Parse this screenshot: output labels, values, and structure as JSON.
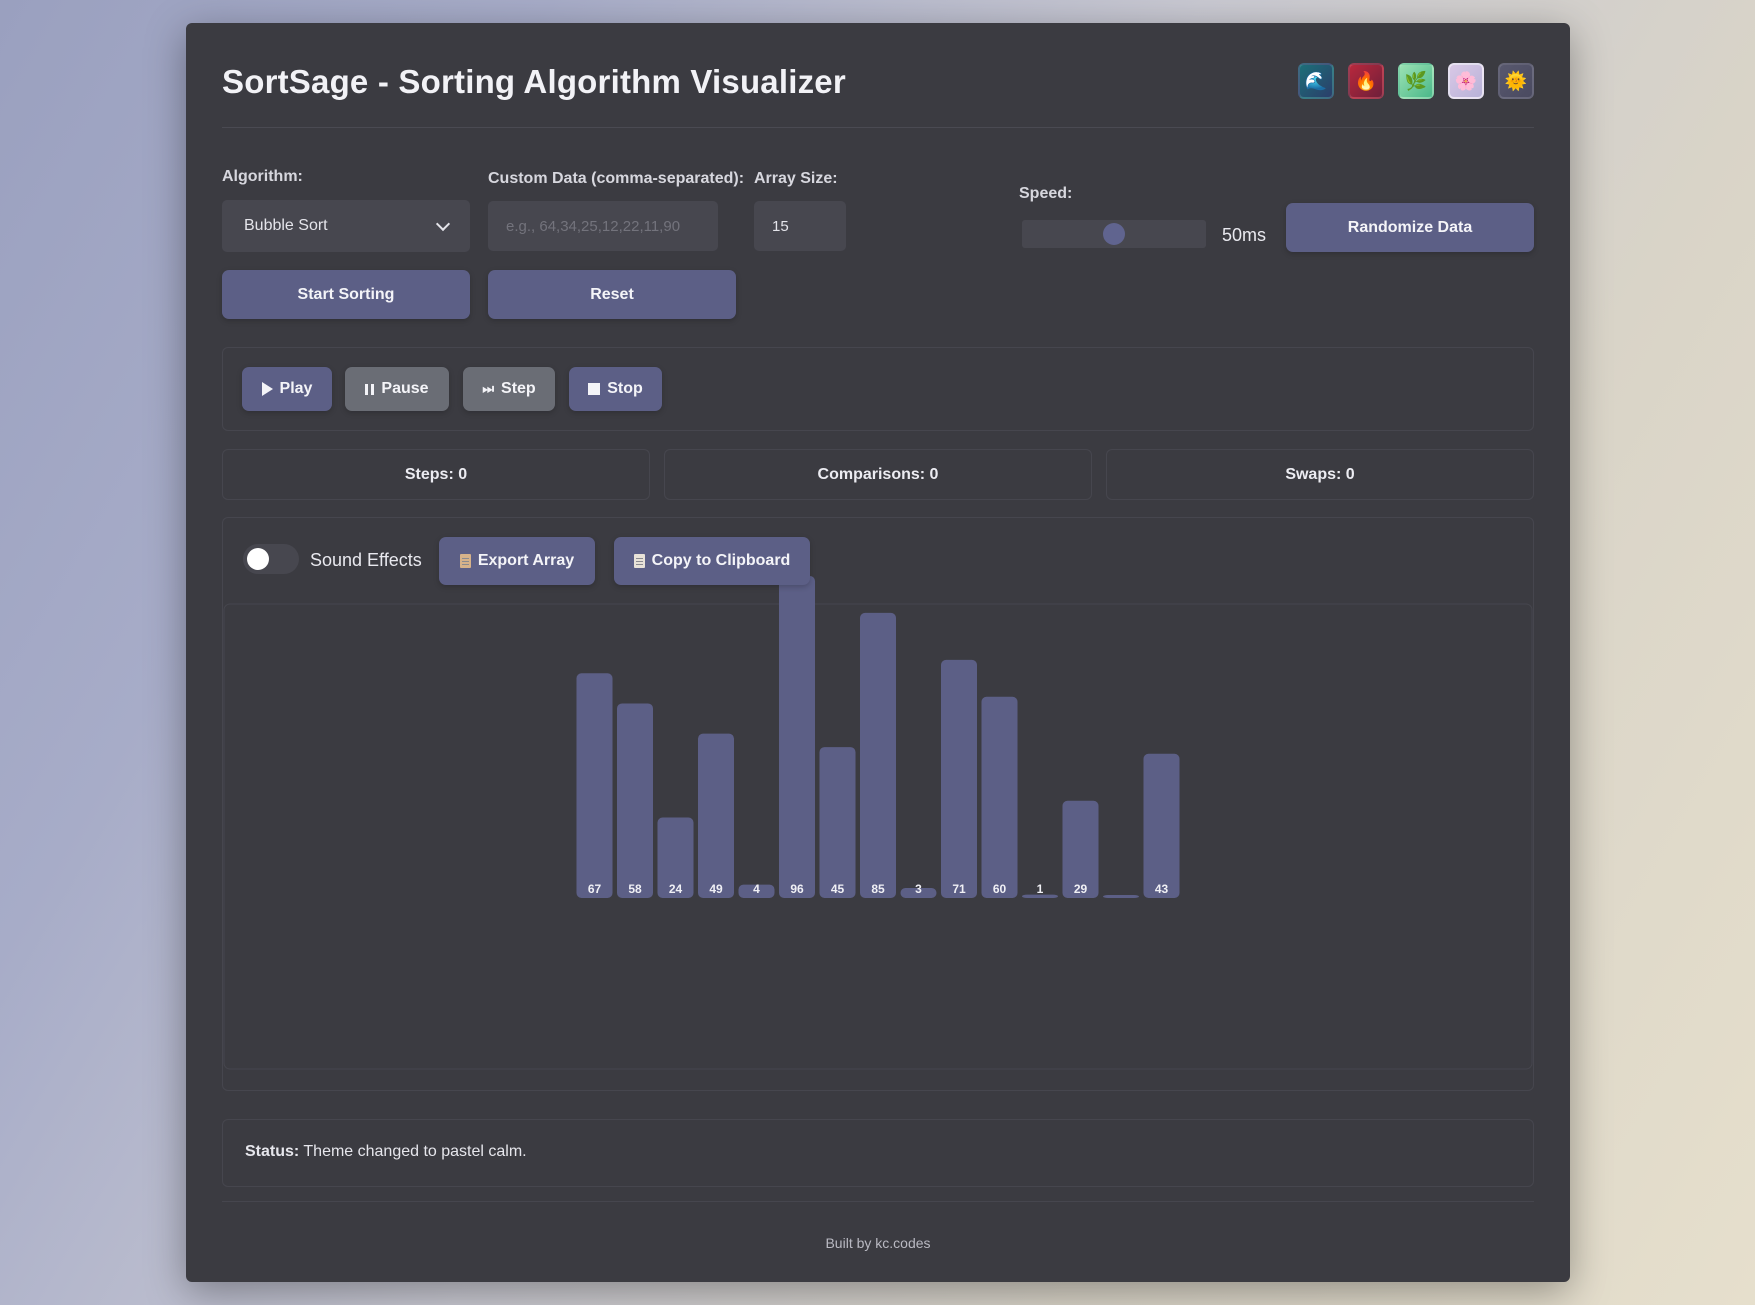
{
  "app": {
    "title": "SortSage - Sorting Algorithm Visualizer",
    "themes": [
      {
        "name": "ocean",
        "glyph": "🌊"
      },
      {
        "name": "fire",
        "glyph": "🔥"
      },
      {
        "name": "forest",
        "glyph": "🌿"
      },
      {
        "name": "pastel",
        "glyph": "🌸"
      },
      {
        "name": "sun",
        "glyph": "🌞"
      }
    ]
  },
  "controls": {
    "algorithm_label": "Algorithm:",
    "algorithm_value": "Bubble Sort",
    "custom_label": "Custom Data (comma-separated):",
    "custom_placeholder": "e.g., 64,34,25,12,22,11,90",
    "size_label": "Array Size:",
    "size_value": "15",
    "speed_label": "Speed:",
    "speed_fraction": 0.5,
    "speed_value": "50ms",
    "randomize_label": "Randomize Data",
    "start_label": "Start Sorting",
    "reset_label": "Reset"
  },
  "playback": {
    "play": "Play",
    "pause": "Pause",
    "step": "Step",
    "stop": "Stop"
  },
  "stats": {
    "steps": "Steps: 0",
    "comparisons": "Comparisons: 0",
    "swaps": "Swaps: 0"
  },
  "tools": {
    "sound_label": "Sound Effects",
    "sound_on": false,
    "export_label": "Export Array",
    "copy_label": "Copy to Clipboard"
  },
  "chart_data": {
    "type": "bar",
    "values": [
      67,
      58,
      24,
      49,
      4,
      96,
      45,
      85,
      3,
      71,
      60,
      1,
      29,
      0,
      43
    ],
    "labels": [
      "67",
      "58",
      "24",
      "49",
      "4",
      "96",
      "45",
      "85",
      "3",
      "71",
      "60",
      "1",
      "29",
      "",
      "43"
    ],
    "ylim": [
      0,
      96
    ],
    "bar_color": "#5c5f86"
  },
  "status": {
    "label": "Status:",
    "message": " Theme changed to pastel calm."
  },
  "footer": {
    "credit": "Built by kc.codes"
  }
}
